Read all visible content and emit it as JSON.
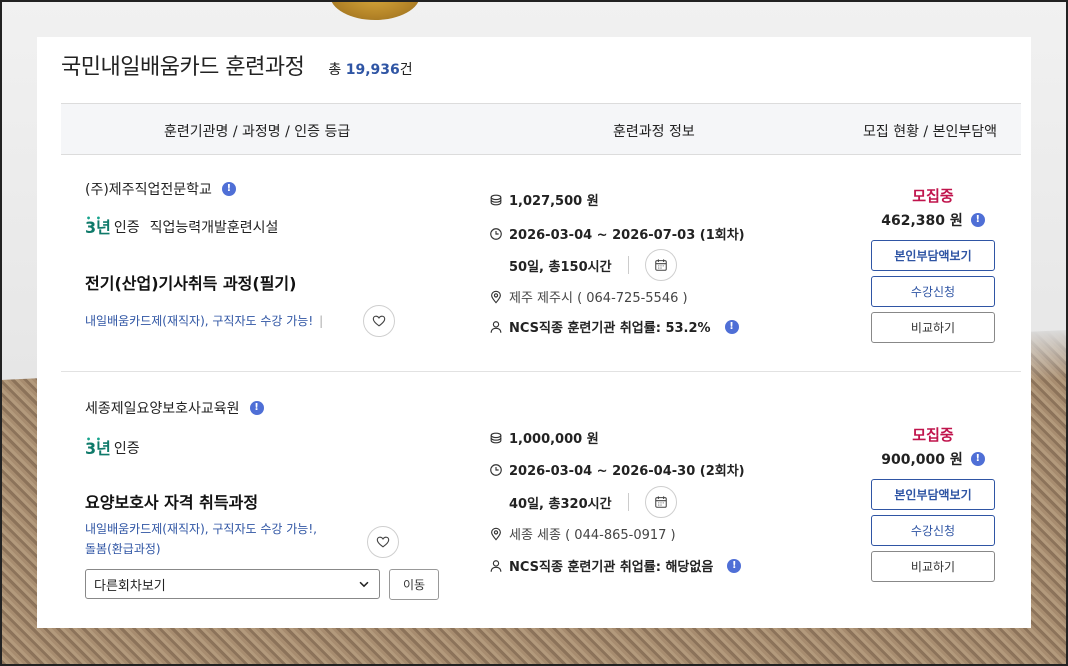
{
  "header": {
    "title": "국민내일배움카드 훈련과정",
    "total_prefix": "총",
    "total_count": "19,936",
    "total_suffix": "건"
  },
  "table_header": {
    "col1": "훈련기관명 / 과정명 / 인증 등급",
    "col2": "훈련과정 정보",
    "col3": "모집 현황 / 본인부담액"
  },
  "courses": [
    {
      "institution": "(주)제주직업전문학교",
      "cert_year": "3년",
      "cert_label": "인증",
      "cert_type": "직업능력개발훈련시설",
      "name": "전기(산업)기사취득 과정(필기)",
      "tags_line1": "내일배움카드제(재직자), 구직자도 수강 가능!",
      "price": "1,027,500 원",
      "period": "2026-03-04 ~ 2026-07-03 (1회차)",
      "duration": "50일, 총150시간",
      "location": "제주 제주시 ( 064-725-5546 )",
      "employment": "NCS직종 훈련기관 취업률: 53.2%",
      "status": "모집중",
      "self_pay": "462,380 원",
      "btn_self_pay": "본인부담액보기",
      "btn_apply": "수강신청",
      "btn_compare": "비교하기"
    },
    {
      "institution": "세종제일요양보호사교육원",
      "cert_year": "3년",
      "cert_label": "인증",
      "name": "요양보호사 자격 취득과정",
      "tags_line1": "내일배움카드제(재직자), 구직자도 수강 가능!,",
      "tags_line2": "돌봄(환급과정)",
      "select_value": "다른회차보기",
      "btn_go": "이동",
      "price": "1,000,000 원",
      "period": "2026-03-04 ~ 2026-04-30 (2회차)",
      "duration": "40일, 총320시간",
      "location": "세종 세종 ( 044-865-0917 )",
      "employment": "NCS직종 훈련기관 취업률: 해당없음",
      "status": "모집중",
      "self_pay": "900,000 원",
      "btn_self_pay": "본인부담액보기",
      "btn_apply": "수강신청",
      "btn_compare": "비교하기"
    }
  ]
}
